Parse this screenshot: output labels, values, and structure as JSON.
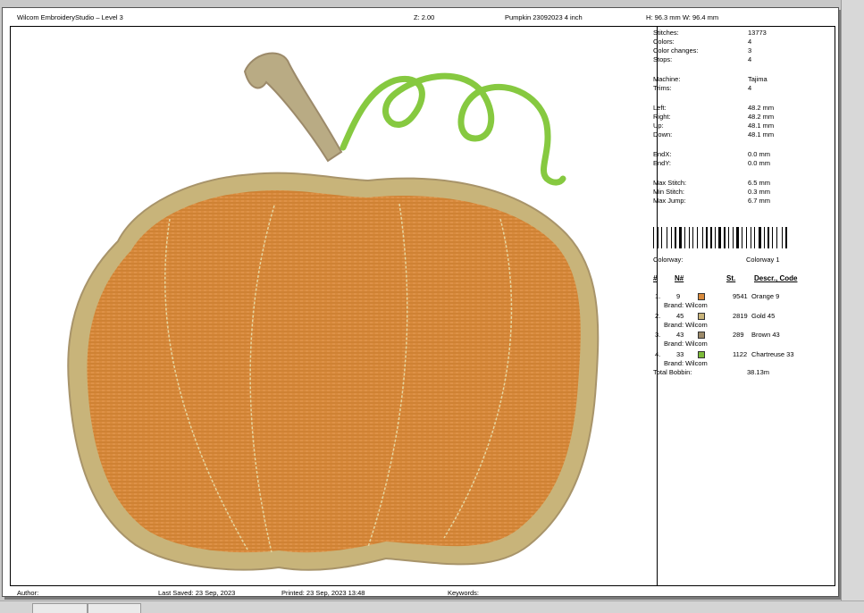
{
  "header": {
    "app_title": "Wilcom EmbroideryStudio – Level 3",
    "zoom": "Z: 2.00",
    "design_name": "Pumpkin 23092023 4 inch",
    "dimensions": "H: 96.3 mm   W: 96.4 mm"
  },
  "stats": [
    {
      "label": "Stitches:",
      "value": "13773"
    },
    {
      "label": "Colors:",
      "value": "4"
    },
    {
      "label": "Color changes:",
      "value": "3"
    },
    {
      "label": "Stops:",
      "value": "4"
    },
    {
      "label": "Machine:",
      "value": "Tajima"
    },
    {
      "label": "Trims:",
      "value": "4"
    },
    {
      "label": "Left:",
      "value": "48.2 mm"
    },
    {
      "label": "Right:",
      "value": "48.2 mm"
    },
    {
      "label": "Up:",
      "value": "48.1 mm"
    },
    {
      "label": "Down:",
      "value": "48.1 mm"
    },
    {
      "label": "EndX:",
      "value": "0.0 mm"
    },
    {
      "label": "EndY:",
      "value": "0.0 mm"
    },
    {
      "label": "Max Stitch:",
      "value": "6.5 mm"
    },
    {
      "label": "Min Stitch:",
      "value": "0.3 mm"
    },
    {
      "label": "Max Jump:",
      "value": "6.7 mm"
    }
  ],
  "colorway": {
    "label": "Colorway:",
    "value": "Colorway 1"
  },
  "table_headers": {
    "num": "#",
    "needle": "N#",
    "stitches": "St.",
    "descr": "Descr., Code"
  },
  "threads": [
    {
      "index": "1.",
      "needle": "9",
      "color": "#d88a3c",
      "stitches": "9541",
      "descr": "Orange 9",
      "brand": "Brand: Wilcom"
    },
    {
      "index": "2.",
      "needle": "45",
      "color": "#c8b47a",
      "stitches": "2819",
      "descr": "Gold 45",
      "brand": "Brand: Wilcom"
    },
    {
      "index": "3.",
      "needle": "43",
      "color": "#9c8a6a",
      "stitches": "289",
      "descr": "Brown 43",
      "brand": "Brand: Wilcom"
    },
    {
      "index": "4.",
      "needle": "33",
      "color": "#7cbb3a",
      "stitches": "1122",
      "descr": "Chartreuse 33",
      "brand": "Brand: Wilcom"
    }
  ],
  "total_bobbin": {
    "label": "Total Bobbin:",
    "value": "38.13m"
  },
  "footer": {
    "author": "Author:",
    "last_saved": "Last Saved: 23 Sep, 2023",
    "printed": "Printed: 23 Sep, 2023 13:48",
    "keywords": "Keywords:"
  },
  "colors": {
    "pumpkin_fill": "#d88a3c",
    "pumpkin_outline": "#c8b47a",
    "stem": "#b9ab84",
    "vine": "#86c940"
  }
}
